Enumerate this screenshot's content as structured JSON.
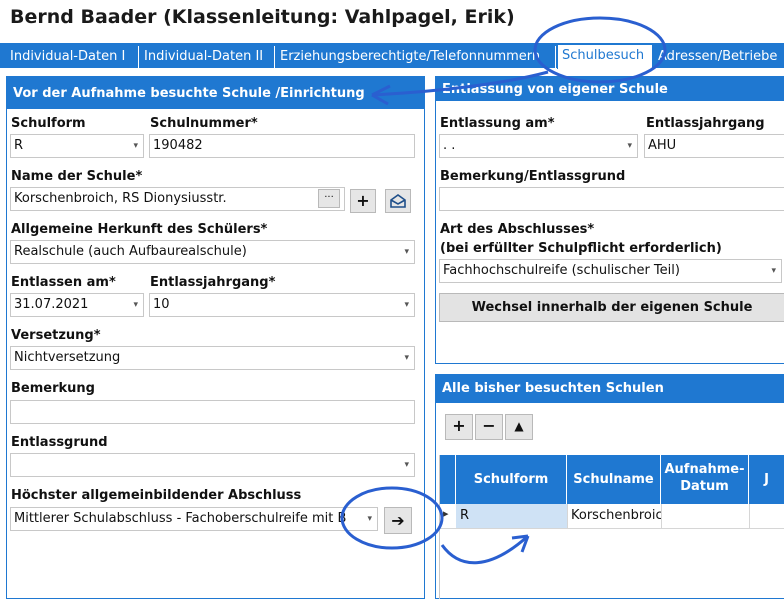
{
  "header": {
    "title": "Bernd Baader (Klassenleitung: Vahlpagel, Erik)"
  },
  "tabs": [
    {
      "label": "Individual-Daten I"
    },
    {
      "label": "Individual-Daten II"
    },
    {
      "label": "Erziehungsberechtigte/Telefonnummern"
    },
    {
      "label": "Schulbesuch"
    },
    {
      "label": "Adressen/Betriebe"
    }
  ],
  "left": {
    "title": "Vor der Aufnahme besuchte Schule /Einrichtung",
    "schulform_label": "Schulform",
    "schulform_value": "R",
    "schulnummer_label": "Schulnummer*",
    "schulnummer_value": "190482",
    "name_label": "Name der Schule*",
    "name_value": "Korschenbroich, RS Dionysiusstr.",
    "name_more": "···",
    "name_add": "+",
    "herkunft_label": "Allgemeine Herkunft des Schülers*",
    "herkunft_value": "Realschule (auch Aufbaurealschule)",
    "entlassen_label": "Entlassen am*",
    "entlassen_value": "31.07.2021",
    "entlassjahrgang_label": "Entlassjahrgang*",
    "entlassjahrgang_value": "10",
    "versetzung_label": "Versetzung*",
    "versetzung_value": "Nichtversetzung",
    "bemerkung_label": "Bemerkung",
    "bemerkung_value": "",
    "entlassgrund_label": "Entlassgrund",
    "entlassgrund_value": "",
    "abschluss_label": "Höchster allgemeinbildender Abschluss",
    "abschluss_value": "Mittlerer Schulabschluss - Fachoberschulreife mit B"
  },
  "right": {
    "title": "Entlassung von eigener Schule",
    "entlassung_label": "Entlassung am*",
    "entlassung_value": " .  .",
    "entlassjahrgang_label": "Entlassjahrgang",
    "entlassjahrgang_value": "AHU",
    "bemerkung_label": "Bemerkung/Entlassgrund",
    "bemerkung_value": "",
    "abschluss_label_1": "Art des Abschlusses*",
    "abschluss_label_2": "(bei erfüllter Schulpflicht erforderlich)",
    "abschluss_value": "Fachhochschulreife (schulischer Teil)",
    "wechsel_button": "Wechsel innerhalb der eigenen Schule"
  },
  "schools": {
    "title": "Alle bisher besuchten Schulen",
    "buttons": {
      "add": "+",
      "remove": "−",
      "up": "▲"
    },
    "columns": [
      "Schulform",
      "Schulname",
      "Aufnahme-Datum",
      "J"
    ],
    "rows": [
      {
        "schulform": "R",
        "schulname": "Korschenbroich"
      }
    ]
  },
  "icons": {
    "dropdown": "▾",
    "arrow": "➔"
  },
  "colors": {
    "accent": "#1f78d1",
    "annotation": "#2a5fd0"
  }
}
